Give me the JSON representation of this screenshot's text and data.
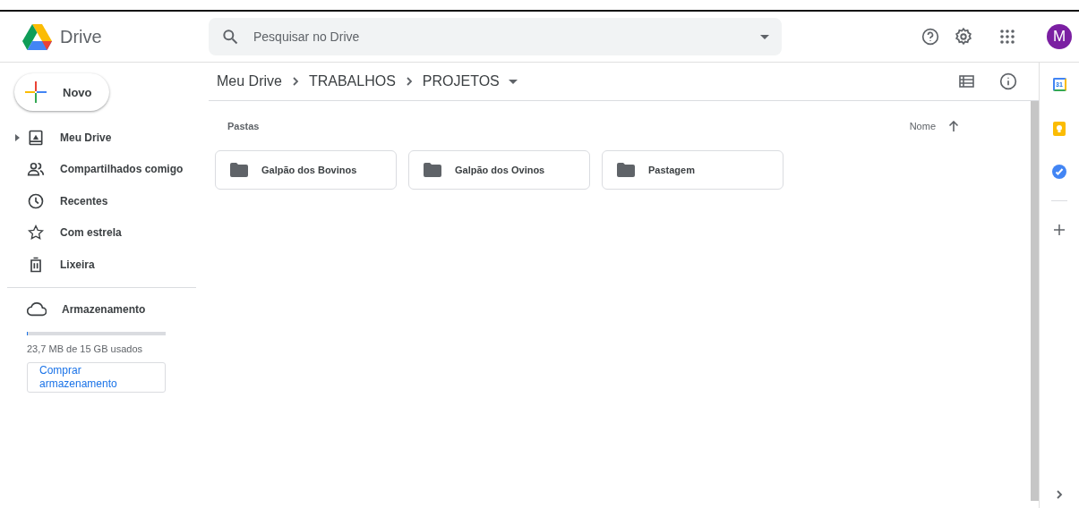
{
  "header": {
    "app_name": "Drive",
    "search": {
      "placeholder": "Pesquisar no Drive"
    },
    "avatar": "M"
  },
  "new_button": "Novo",
  "sidebar": {
    "items": [
      {
        "kind": "drive",
        "label": "Meu Drive",
        "selected": false,
        "expandable": true
      },
      {
        "kind": "shared",
        "label": "Compartilhados comigo",
        "selected": false,
        "expandable": false
      },
      {
        "kind": "recent",
        "label": "Recentes",
        "selected": false,
        "expandable": false
      },
      {
        "kind": "starred",
        "label": "Com estrela",
        "selected": false,
        "expandable": false
      },
      {
        "kind": "trash",
        "label": "Lixeira",
        "selected": false,
        "expandable": false
      }
    ],
    "storage": {
      "label": "Armazenamento",
      "level": 0.002,
      "usage": "23,7 MB de 15 GB usados",
      "buy_button": "Comprar armazenamento"
    }
  },
  "breadcrumb": [
    "Meu Drive",
    "TRABALHOS",
    "PROJETOS"
  ],
  "section_title": "Pastas",
  "sort": {
    "label": "Nome"
  },
  "folders": [
    {
      "name": "Galpão dos Bovinos"
    },
    {
      "name": "Galpão dos Ovinos"
    },
    {
      "name": "Pastagem"
    }
  ],
  "side_panel": {
    "calendar_day": "31"
  }
}
